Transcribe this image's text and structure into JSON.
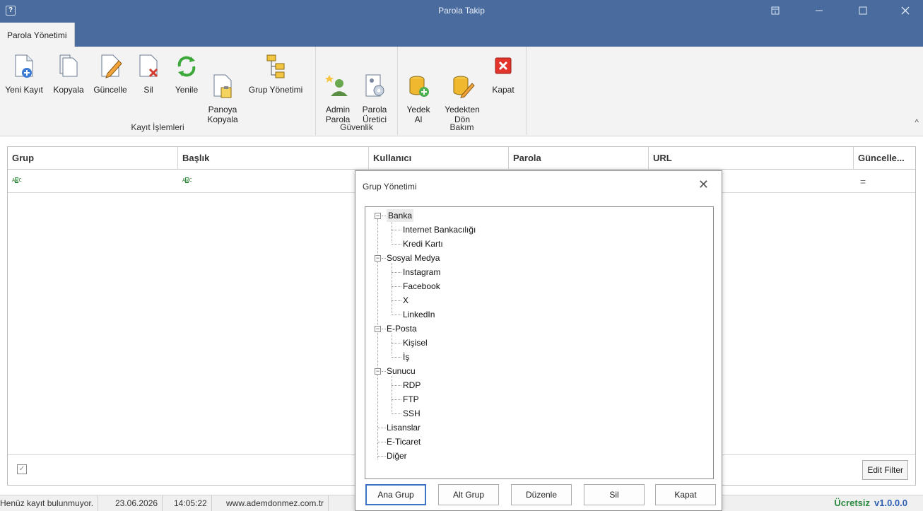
{
  "window": {
    "title": "Parola Takip",
    "app_icon": "?"
  },
  "ribbon": {
    "tab": "Parola Yönetimi",
    "groups": [
      {
        "label": "Kayıt İşlemleri",
        "buttons": [
          {
            "label": "Yeni Kayıt",
            "icon": "new-record-icon"
          },
          {
            "label": "Kopyala",
            "icon": "copy-icon"
          },
          {
            "label": "Güncelle",
            "icon": "edit-icon"
          },
          {
            "label": "Sil",
            "icon": "delete-icon"
          },
          {
            "label": "Yenile",
            "icon": "refresh-icon"
          },
          {
            "label": "Panoya\nKopyala",
            "icon": "clipboard-icon"
          },
          {
            "label": "Grup Yönetimi",
            "icon": "tree-icon"
          }
        ]
      },
      {
        "label": "Güvenlik",
        "buttons": [
          {
            "label": "Admin\nParola",
            "icon": "admin-user-icon"
          },
          {
            "label": "Parola\nÜretici",
            "icon": "generator-icon"
          }
        ]
      },
      {
        "label": "Bakım",
        "buttons": [
          {
            "label": "Yedek\nAl",
            "icon": "backup-icon"
          },
          {
            "label": "Yedekten\nDön",
            "icon": "restore-icon"
          },
          {
            "label": "Kapat",
            "icon": "close-red-icon"
          }
        ]
      }
    ],
    "collapse_icon": "^"
  },
  "grid": {
    "columns": [
      "Grup",
      "Başlık",
      "Kullanıcı",
      "Parola",
      "URL",
      "Güncelle..."
    ],
    "filter_row_icon": "abc-filter-icon",
    "equals_icon": "=",
    "edit_filter": "Edit Filter",
    "check_icon": "✓"
  },
  "status": {
    "message": "Henüz kayıt bulunmuyor.",
    "date": "23.06.2026",
    "time": "14:05:22",
    "website": "www.ademdonmez.com.tr",
    "license": "Ücretsiz",
    "version": "v1.0.0.0"
  },
  "dialog": {
    "title": "Grup Yönetimi",
    "close": "✕",
    "tree": [
      {
        "label": "Banka",
        "children": [
          "Internet Bankacılığı",
          "Kredi Kartı"
        ]
      },
      {
        "label": "Sosyal Medya",
        "children": [
          "Instagram",
          "Facebook",
          "X",
          "LinkedIn"
        ]
      },
      {
        "label": "E-Posta",
        "children": [
          "Kişisel",
          "İş"
        ]
      },
      {
        "label": "Sunucu",
        "children": [
          "RDP",
          "FTP",
          "SSH"
        ]
      },
      {
        "label": "Lisanslar",
        "children": []
      },
      {
        "label": "E-Ticaret",
        "children": []
      },
      {
        "label": "Diğer",
        "children": []
      }
    ],
    "buttons": [
      "Ana Grup",
      "Alt Grup",
      "Düzenle",
      "Sil",
      "Kapat"
    ]
  }
}
